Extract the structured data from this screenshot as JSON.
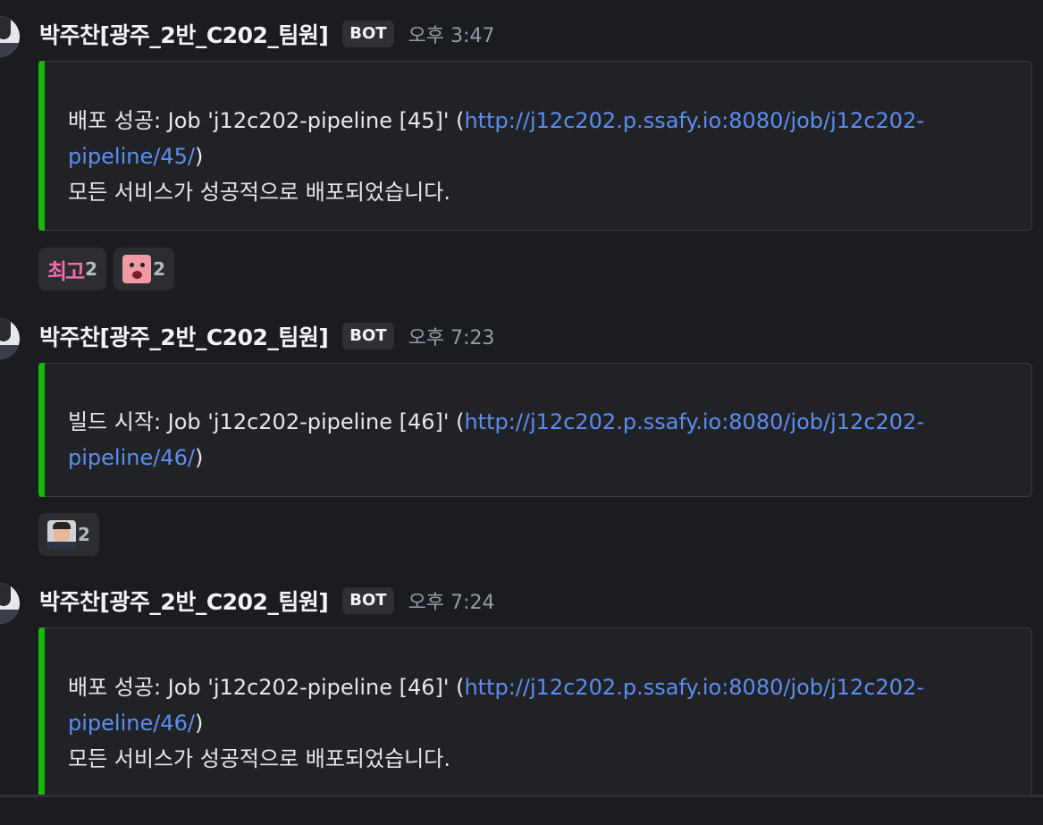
{
  "messages": [
    {
      "username": "박주찬[광주_2반_C202_팀원]",
      "badge": "BOT",
      "time": "오후 3:47",
      "embed": {
        "prefix": "배포 성공: Job 'j12c202-pipeline [45]' (",
        "link": "http://j12c202.p.ssafy.io:8080/job/j12c202-pipeline/45/",
        "suffix": ")",
        "line2": "모든 서비스가 성공적으로 배포되었습니다."
      },
      "reactions": [
        {
          "emoji": "최고",
          "count": "2"
        },
        {
          "emoji": "pig-face-emoji",
          "count": "2"
        }
      ]
    },
    {
      "username": "박주찬[광주_2반_C202_팀원]",
      "badge": "BOT",
      "time": "오후 7:23",
      "embed": {
        "prefix": "빌드 시작: Job 'j12c202-pipeline [46]' (",
        "link": "http://j12c202.p.ssafy.io:8080/job/j12c202-pipeline/46/",
        "suffix": ")"
      },
      "reactions": [
        {
          "emoji": "man-face-emoji",
          "count": "2"
        }
      ]
    },
    {
      "username": "박주찬[광주_2반_C202_팀원]",
      "badge": "BOT",
      "time": "오후 7:24",
      "embed": {
        "prefix": "배포 성공: Job 'j12c202-pipeline [46]' (",
        "link": "http://j12c202.p.ssafy.io:8080/job/j12c202-pipeline/46/",
        "suffix": ")",
        "line2": "모든 서비스가 성공적으로 배포되었습니다."
      }
    }
  ],
  "colors": {
    "embed_accent": "#17b80c",
    "link": "#5b8ef0",
    "background": "#1b1c20"
  }
}
